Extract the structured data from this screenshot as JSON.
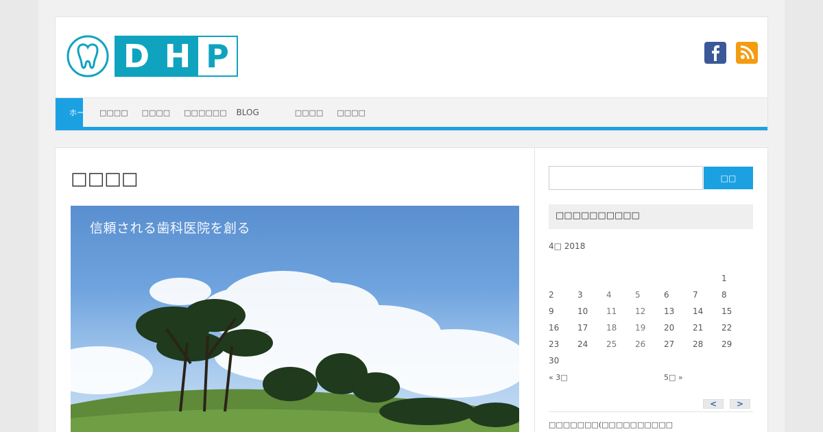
{
  "header": {
    "logo_letters": [
      "D",
      "H",
      "P"
    ],
    "brand_color": "#0fa3bf",
    "social": [
      {
        "icon": "facebook-icon",
        "color": "#3b5998"
      },
      {
        "icon": "rss-icon",
        "color": "#f39c12"
      }
    ]
  },
  "nav": {
    "accent": "#1ba1e2",
    "home": "ホーム",
    "items": [
      "□□□□",
      "□□□□",
      "□□□□□□",
      "BLOG",
      "□□□□",
      "□□□□"
    ]
  },
  "main": {
    "title": "□□□□",
    "hero_caption": "信頼される歯科医院を創る"
  },
  "sidebar": {
    "search_button": "□□",
    "widget_title": "□□□□□□□□□□",
    "calendar": {
      "caption": "4□ 2018",
      "rows": [
        [
          "",
          "",
          "",
          "",
          "",
          "",
          "1"
        ],
        [
          "2",
          "3",
          "4",
          "5",
          "6",
          "7",
          "8"
        ],
        [
          "9",
          "10",
          "11",
          "12",
          "13",
          "14",
          "15"
        ],
        [
          "16",
          "17",
          "18",
          "19",
          "20",
          "21",
          "22"
        ],
        [
          "23",
          "24",
          "25",
          "26",
          "27",
          "28",
          "29"
        ],
        [
          "30",
          "",
          "",
          "",
          "",
          "",
          ""
        ]
      ],
      "prev": "« 3□",
      "next": "5□ »"
    },
    "pager_prev": "<",
    "pager_next": ">",
    "recent_post": "□□□□□□□(□□□□□□□□□□"
  }
}
